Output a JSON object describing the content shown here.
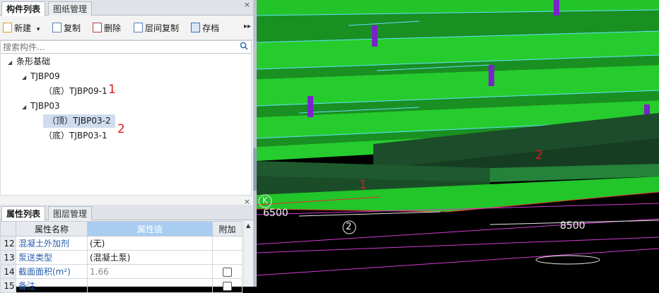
{
  "component_panel": {
    "tabs": [
      {
        "label": "构件列表",
        "active": true
      },
      {
        "label": "图纸管理",
        "active": false
      }
    ],
    "close_label": "×",
    "toolbar": {
      "new_label": "新建",
      "new_dropdown": "▾",
      "copy_label": "复制",
      "delete_label": "删除",
      "floor_copy_label": "层间复制",
      "save_label": "存档",
      "more": "▸▸"
    },
    "search_placeholder": "搜索构件...",
    "tree": {
      "root": "条形基础",
      "groups": [
        {
          "name": "TJBP09",
          "items": [
            {
              "label": "（底）TJBP09-1",
              "selected": false
            }
          ]
        },
        {
          "name": "TJBP03",
          "items": [
            {
              "label": "（顶）TJBP03-2",
              "selected": true
            },
            {
              "label": "（底）TJBP03-1",
              "selected": false
            }
          ]
        }
      ],
      "annotations": [
        "1",
        "2"
      ]
    }
  },
  "property_panel": {
    "tabs": [
      {
        "label": "属性列表",
        "active": true
      },
      {
        "label": "图层管理",
        "active": false
      }
    ],
    "close_label": "×",
    "headers": {
      "name": "属性名称",
      "value": "属性值",
      "extra": "附加"
    },
    "rows": [
      {
        "num": "12",
        "name": "混凝土外加剂",
        "value": "(无)",
        "checkbox": false
      },
      {
        "num": "13",
        "name": "泵送类型",
        "value": "(混凝土泵)",
        "checkbox": false
      },
      {
        "num": "14",
        "name": "截面面积(m²)",
        "value": "1.66",
        "checkbox": true
      },
      {
        "num": "15",
        "name": "备注",
        "value": "",
        "checkbox": true
      }
    ]
  },
  "viewport": {
    "labels": {
      "dim_left": "6500",
      "dim_right": "8500",
      "axis_mark": "2",
      "axis_k": "K",
      "annot_1": "1",
      "annot_2": "2"
    },
    "colors": {
      "slab": "#22c72b",
      "beam": "#1b4a28",
      "edge": "#5fe0ff",
      "column": "#7a22cc",
      "grid": "#d13bd1",
      "annotation": "#e01a1a"
    }
  }
}
